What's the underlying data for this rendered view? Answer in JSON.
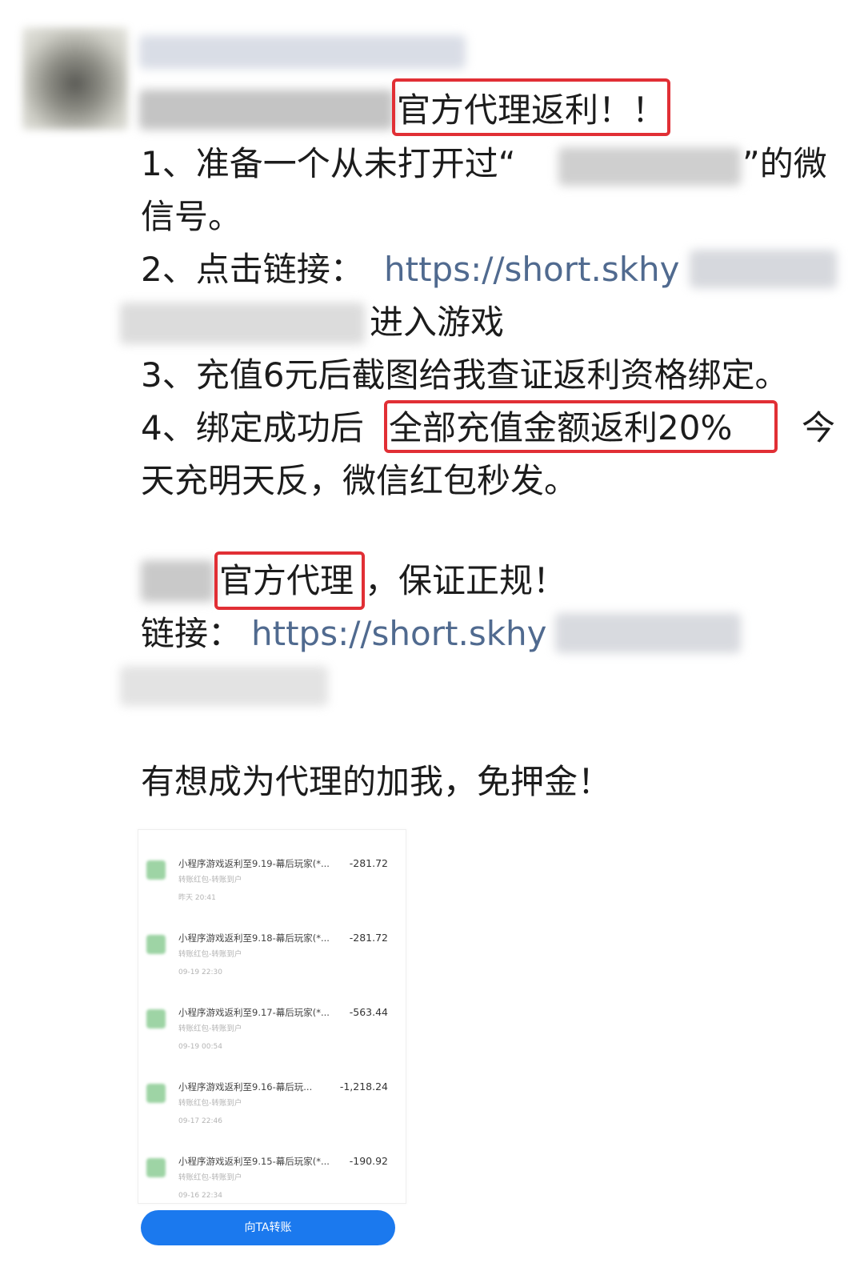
{
  "post": {
    "line1_tail": "官方代理返利！！",
    "line2a": "1、准备一个从未打开过“",
    "line2b": "”的微",
    "line3": "信号。",
    "line4_prefix": "2、点击链接：",
    "link1": "https://short.skhy",
    "line5": "进入游戏",
    "line6": "3、充值6元后截图给我查证返利资格绑定。",
    "line7_prefix": "4、绑定成功后",
    "line7_highlight": "全部充值金额返利20%",
    "line7_suffix": "今",
    "line8": "天充明天反，微信红包秒发。",
    "line9_highlight": "官方代理",
    "line9_suffix": "，保证正规！",
    "line10_prefix": "链接：",
    "link2": "https://short.skhy",
    "line11": "有想成为代理的加我，免押金！"
  },
  "screenshot": {
    "transactions": [
      {
        "title": "小程序游戏返利至9.19-幕后玩家(*...",
        "amount": "-281.72",
        "sub": "转账红包-转账到户",
        "time": "昨天 20:41"
      },
      {
        "title": "小程序游戏返利至9.18-幕后玩家(*...",
        "amount": "-281.72",
        "sub": "转账红包-转账到户",
        "time": "09-19 22:30"
      },
      {
        "title": "小程序游戏返利至9.17-幕后玩家(*...",
        "amount": "-563.44",
        "sub": "转账红包-转账到户",
        "time": "09-19 00:54"
      },
      {
        "title": "小程序游戏返利至9.16-幕后玩...",
        "amount": "-1,218.24",
        "sub": "转账红包-转账到户",
        "time": "09-17 22:46"
      },
      {
        "title": "小程序游戏返利至9.15-幕后玩家(*...",
        "amount": "-190.92",
        "sub": "转账红包-转账到户",
        "time": "09-16 22:34"
      }
    ],
    "button_label": "向TA转账"
  },
  "colors": {
    "highlight_border": "#e12f35",
    "link": "#506a8f",
    "button": "#1b79ee"
  }
}
